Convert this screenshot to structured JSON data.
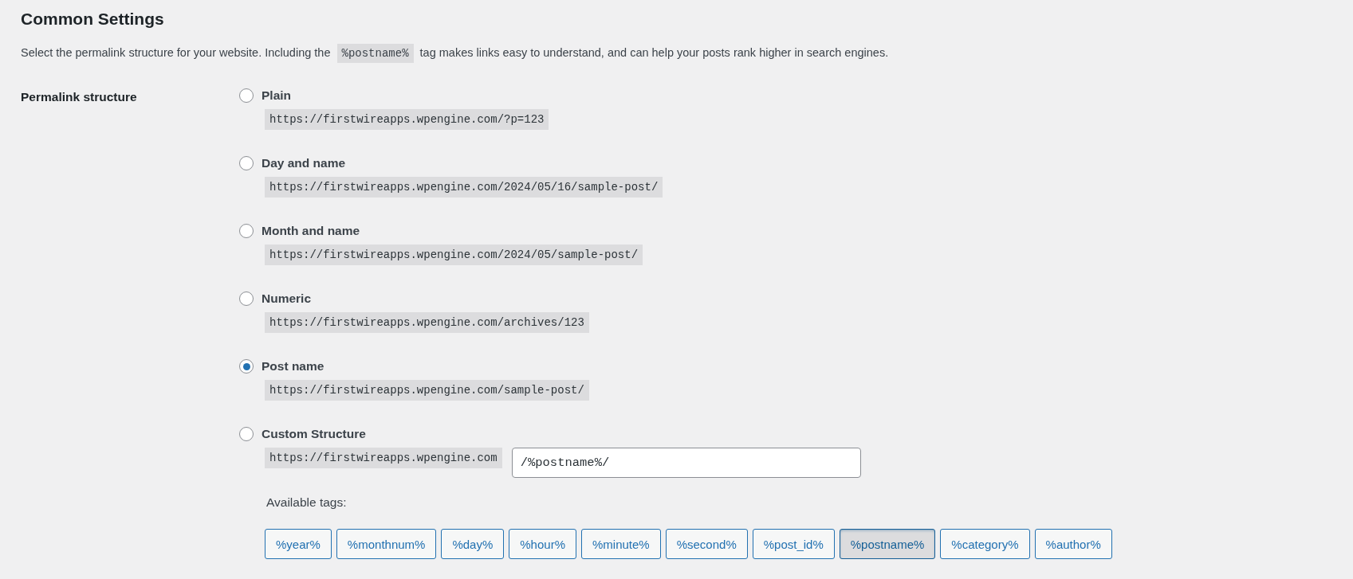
{
  "heading": "Common Settings",
  "description": {
    "before": "Select the permalink structure for your website. Including the",
    "code": "%postname%",
    "after": "tag makes links easy to understand, and can help your posts rank higher in search engines."
  },
  "field_label": "Permalink structure",
  "options": [
    {
      "label": "Plain",
      "example": "https://firstwireapps.wpengine.com/?p=123",
      "selected": false
    },
    {
      "label": "Day and name",
      "example": "https://firstwireapps.wpengine.com/2024/05/16/sample-post/",
      "selected": false
    },
    {
      "label": "Month and name",
      "example": "https://firstwireapps.wpengine.com/2024/05/sample-post/",
      "selected": false
    },
    {
      "label": "Numeric",
      "example": "https://firstwireapps.wpengine.com/archives/123",
      "selected": false
    },
    {
      "label": "Post name",
      "example": "https://firstwireapps.wpengine.com/sample-post/",
      "selected": true
    },
    {
      "label": "Custom Structure",
      "selected": false
    }
  ],
  "custom": {
    "prefix": "https://firstwireapps.wpengine.com",
    "value": "/%postname%/",
    "tags_label": "Available tags:",
    "tags": [
      {
        "label": "%year%",
        "selected": false
      },
      {
        "label": "%monthnum%",
        "selected": false
      },
      {
        "label": "%day%",
        "selected": false
      },
      {
        "label": "%hour%",
        "selected": false
      },
      {
        "label": "%minute%",
        "selected": false
      },
      {
        "label": "%second%",
        "selected": false
      },
      {
        "label": "%post_id%",
        "selected": false
      },
      {
        "label": "%postname%",
        "selected": true
      },
      {
        "label": "%category%",
        "selected": false
      },
      {
        "label": "%author%",
        "selected": false
      }
    ]
  }
}
